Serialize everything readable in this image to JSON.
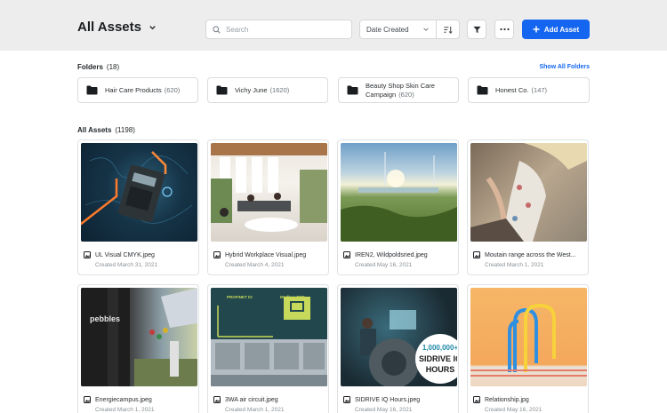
{
  "header": {
    "title": "All Assets",
    "search_placeholder": "Search",
    "sort_label": "Date Created",
    "add_label": "Add Asset"
  },
  "folders_section": {
    "label": "Folders",
    "count": "(18)",
    "show_all": "Show All Folders",
    "items": [
      {
        "name": "Hair Care Products",
        "count": "(620)"
      },
      {
        "name": "Vichy June",
        "count": "(1620)"
      },
      {
        "name": "Beauty Shop Skin Care",
        "name2": "Campaign",
        "count": "(620)"
      },
      {
        "name": "Honest Co.",
        "count": "(147)"
      }
    ]
  },
  "assets_section": {
    "label": "All Assets",
    "count": "(1198)",
    "items": [
      {
        "name": "UL Visual CMYK.jpeg",
        "date": "Created March 31, 2021"
      },
      {
        "name": "Hybrid Workplace Visual.jpeg",
        "date": "Created March 4, 2021"
      },
      {
        "name": "IREN2, Wildpoldsried.jpeg",
        "date": "Created May 16, 2021"
      },
      {
        "name": "Moutain range across the West...",
        "date": "Created March 1, 2021"
      },
      {
        "name": "Energiecampus.jpeg",
        "date": "Created March 1, 2021"
      },
      {
        "name": "3WA air circuit.jpeg",
        "date": "Created March 1, 2021"
      },
      {
        "name": "SIDRIVE IQ Hours.jpeg",
        "date": "Created May 16, 2021"
      },
      {
        "name": "Relationship.jpg",
        "date": "Created May 16, 2021"
      }
    ]
  },
  "thumb_text": {
    "pebbles": "pebbles",
    "profinet": "PROFINET IO",
    "modbus": "Modbus TCP",
    "sidrive_number": "1,000,000+",
    "sidrive_name": "SIDRIVE IQ",
    "sidrive_hours": "HOURS"
  },
  "colors": {
    "accent": "#1466f0",
    "header_bg": "#ededed"
  },
  "icons": {
    "title_chevron": "chevron-down-icon",
    "search": "search-icon",
    "sort_chevron": "chevron-down-icon",
    "sort_direction": "sort-direction-icon",
    "filter": "filter-icon",
    "more": "more-horizontal-icon",
    "add": "plus-icon",
    "folder": "folder-icon",
    "asset": "image-file-icon"
  }
}
